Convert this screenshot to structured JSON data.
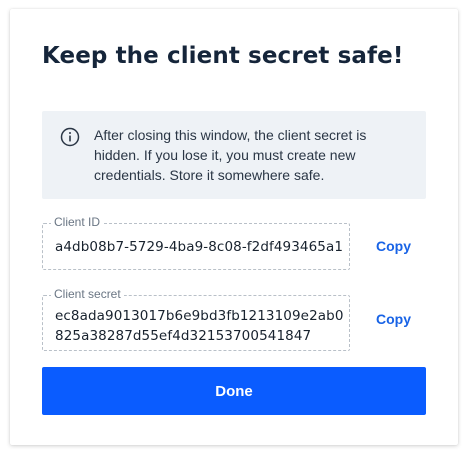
{
  "dialog": {
    "title": "Keep the client secret safe!",
    "info_text": "After closing this window, the client secret is hidden. If you lose it, you must create new credentials. Store it somewhere safe.",
    "info_icon": "info-circle-icon"
  },
  "fields": {
    "client_id": {
      "label": "Client ID",
      "value": "a4db08b7-5729-4ba9-8c08-f2df493465a1",
      "copy_label": "Copy"
    },
    "client_secret": {
      "label": "Client secret",
      "value": "ec8ada9013017b6e9bd3fb1213109e2ab0825a38287d55ef4d32153700541847",
      "copy_label": "Copy"
    }
  },
  "actions": {
    "done_label": "Done"
  },
  "colors": {
    "primary": "#0a5cff",
    "link": "#1863e6",
    "info_bg": "#eef2f6"
  }
}
